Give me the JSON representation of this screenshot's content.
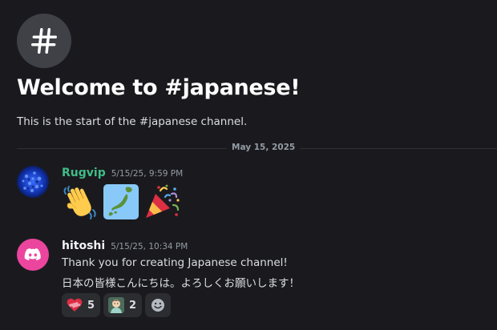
{
  "welcome": {
    "title": "Welcome to #japanese!",
    "subtitle": "This is the start of the #japanese channel."
  },
  "divider": {
    "date": "May 15, 2025"
  },
  "messages": [
    {
      "username": "Rugvip",
      "timestamp": "5/15/25, 9:59 PM",
      "username_color": "#3fbd88",
      "emojis": [
        "waving-hand-emoji",
        "japan-map-emoji",
        "party-popper-emoji"
      ]
    },
    {
      "username": "hitoshi",
      "timestamp": "5/15/25, 10:34 PM",
      "username_color": "#f2f3f5",
      "avatar_color": "#eb459e",
      "lines": [
        "Thank you for creating Japanese channel!",
        "日本の皆様こんにちは。よろしくお願いします！"
      ],
      "reactions": [
        {
          "icon": "heart-bandage-emoji",
          "count": "5"
        },
        {
          "icon": "baby-custom-emoji",
          "count": "2"
        }
      ]
    }
  ],
  "colors": {
    "background": "#1a1a1e",
    "text": "#dbdee1",
    "muted": "#949ba4",
    "reaction_bg": "#2b2d31"
  }
}
